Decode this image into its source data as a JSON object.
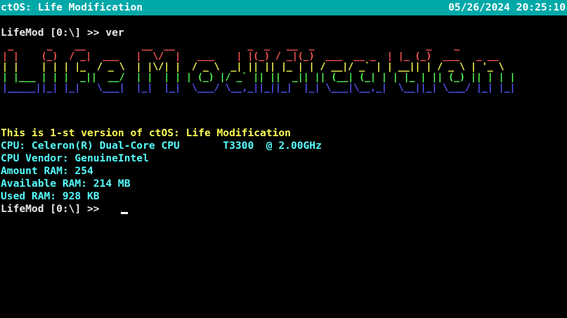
{
  "titlebar": {
    "title": "ctOS: Life Modification",
    "datetime": "05/26/2024 20:25:10",
    "background_color": "#00a8a8"
  },
  "terminal": {
    "command_line": "LifeMod [0:\\] >> ver",
    "banner": {
      "rows": [
        {
          "text": " _      _    __          __  __             _  _   __  _                    _    _                  ",
          "color": "#ff5555"
        },
        {
          "text": "| |    (_)  / _|  ___   |  \\/  |   ___    | |(_) / _|(_)  ___  __ _  | |_ (_)  ___   _ __        ",
          "color": "#ff5555"
        },
        {
          "text": "| |    | | | |_  / _ \\  | |\\/| |  / _ \\  _| || || |_ | | / __|/ _` | | __|| | / _ \\ | '_ \\       ",
          "color": "#ffff55"
        },
        {
          "text": "| |___ | | |  _||  __/  | |  | | | (_) |/ _` || ||  _|| || (__| (_| | | |_ | || (_) || | | |      ",
          "color": "#55ff55"
        },
        {
          "text": "|_____||_| |_|   \\___|  |_|  |_|  \\___/ \\__,_||_||_|  |_| \\___|\\__,_|  \\__||_| \\___/ |_| |_|      ",
          "color": "#5555ff"
        }
      ]
    },
    "info_line": "This is 1-st version of ctOS: Life Modification",
    "cpu_line": "CPU: Celeron(R) Dual-Core CPU       T3300  @ 2.00GHz",
    "vendor_line": "CPU Vendor: GenuineIntel",
    "amount_ram_line": "Amount RAM: 254",
    "available_ram_line": "Available RAM: 214 MB",
    "used_ram_line": "Used RAM: 928 KB",
    "prompt": "LifeMod [0:\\] >> ",
    "colors": {
      "background": "#000000",
      "info": "#ffff55",
      "system": "#55ffff",
      "prompt": "#e8e8e8"
    }
  }
}
